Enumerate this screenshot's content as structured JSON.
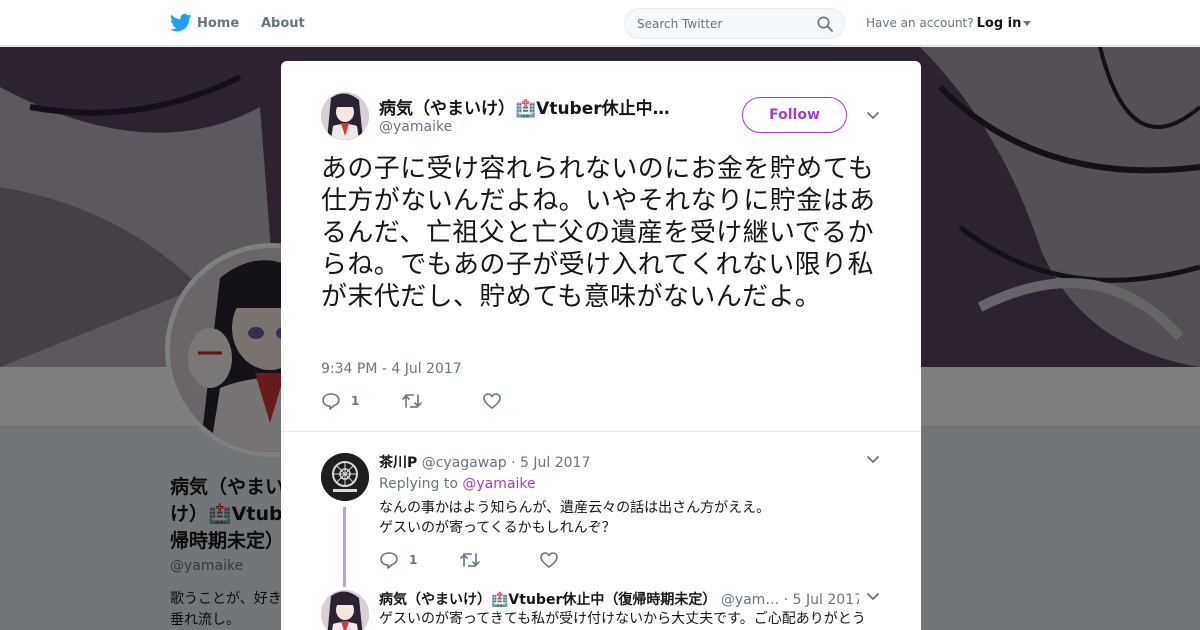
{
  "nav": {
    "home_label": "Home",
    "about_label": "About",
    "search_placeholder": "Search Twitter",
    "have_account": "Have an account?",
    "login_label": "Log in"
  },
  "background_profile": {
    "name": "病気（やまいけ）🏥Vtuber休止中（復帰時期未定）",
    "name_visible": "病気（やまい け）🏥Vtub 帰時期未定）",
    "handle": "@yamaike",
    "bio_visible": "歌うことが、好き 垂れ流し。"
  },
  "tweet": {
    "name": "病気（やまいけ）🏥Vtuber休止中…",
    "handle": "@yamaike",
    "follow_label": "Follow",
    "text": "あの子に受け容れられないのにお金を貯めても仕方がないんだよね。いやそれなりに貯金はあるんだ、亡祖父と亡父の遺産を受け継いでるからね。でもあの子が受け入れてくれない限り私が末代だし、貯めても意味がないんだよ。",
    "timestamp": "9:34 PM - 4 Jul 2017",
    "reply_count": "1"
  },
  "replies": [
    {
      "name": "茶川P",
      "handle": "@cyagawap",
      "date": "· 5 Jul 2017",
      "replying_prefix": "Replying to",
      "replying_to": "@yamaike",
      "text_line1": "なんの事かはよう知らんが、遺産云々の話は出さん方がええ。",
      "text_line2": "ゲスいのが寄ってくるかもしれんぞ？",
      "reply_count": "1"
    },
    {
      "name": "病気（やまいけ）🏥Vtuber休止中（復帰時期未定）",
      "handle": "@yam…",
      "date": "· 5 Jul 2017",
      "text_line1": "ゲスいのが寄ってきても私が受け付けないから大丈夫です。ご心配ありがとう"
    }
  ],
  "colors": {
    "accent": "#a23ec9",
    "twitter_blue": "#1da1f2",
    "muted": "#66757f",
    "thread": "#c59be0"
  }
}
